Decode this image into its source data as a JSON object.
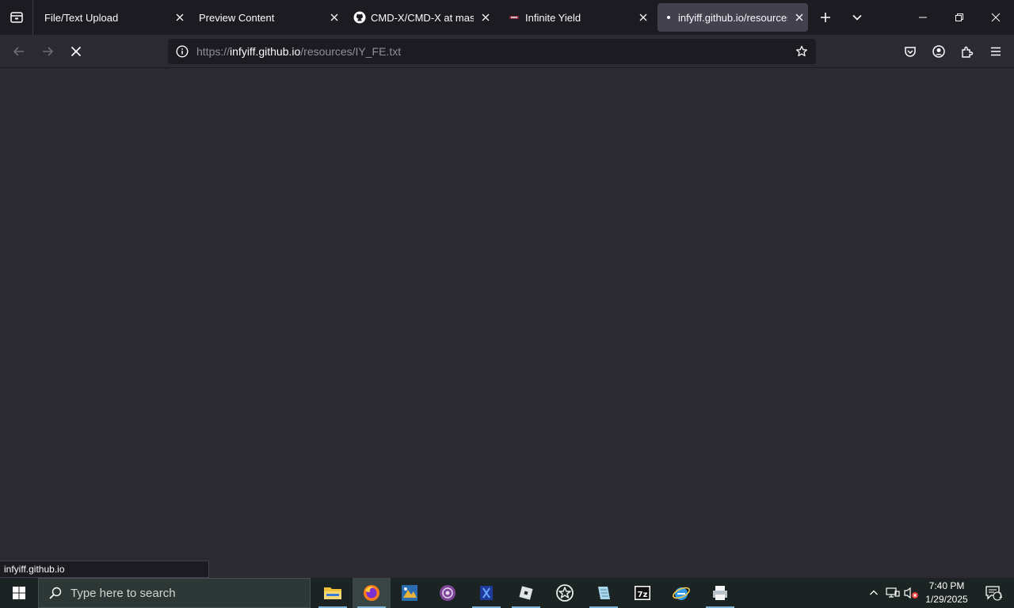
{
  "browser": {
    "tabs": [
      {
        "label": "File/Text Upload",
        "active": false
      },
      {
        "label": "Preview Content",
        "active": false
      },
      {
        "label": "CMD-X/CMD-X at master",
        "active": false
      },
      {
        "label": "Infinite Yield",
        "active": false
      },
      {
        "label": "infyiff.github.io/resources/IY_FE.txt",
        "active": true
      }
    ],
    "url": {
      "scheme": "https://",
      "host": "infyiff.github.io",
      "path": "/resources/IY_FE.txt"
    },
    "status_link": "infyiff.github.io"
  },
  "taskbar": {
    "search_placeholder": "Type here to search",
    "apps": [
      "file-explorer",
      "firefox",
      "paint-app",
      "tor-browser",
      "classic-app",
      "roblox",
      "star-app",
      "notepad-app",
      "7zip",
      "edge-legacy",
      "printer-app"
    ],
    "active_app": "firefox",
    "clock_time": "7:40 PM",
    "clock_date": "1/29/2025",
    "notification_count": "1"
  },
  "colors": {
    "page_bg": "#2b2a33",
    "tabbar_bg": "#1c1b22",
    "active_tab_bg": "#42414d",
    "taskbar_bg": "#1b2422",
    "text": "#fbfbfe"
  }
}
